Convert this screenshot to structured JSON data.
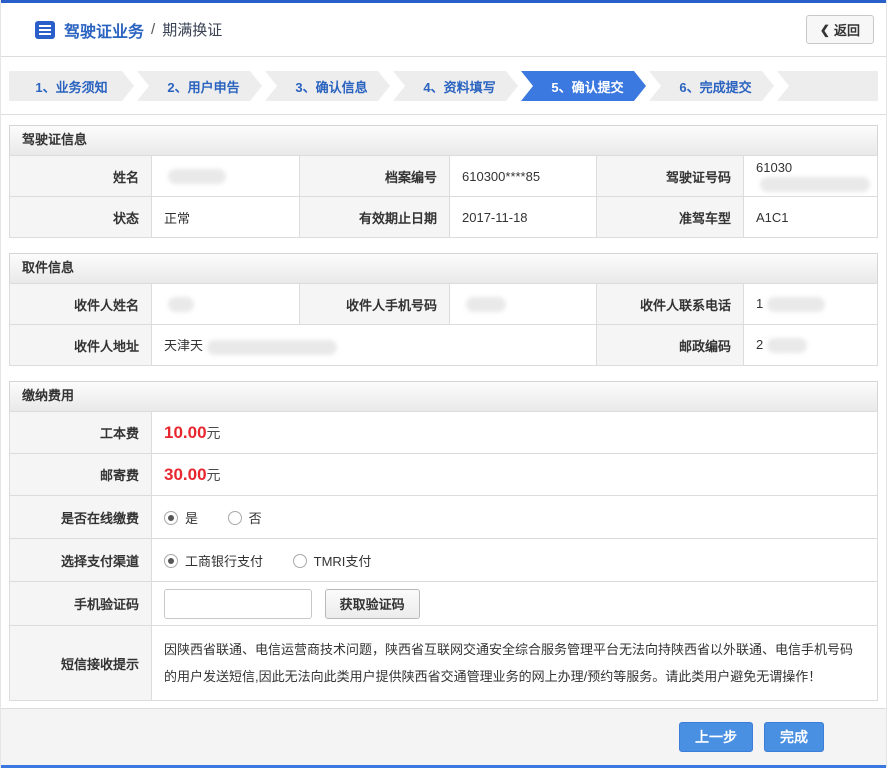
{
  "header": {
    "title_primary": "驾驶证业务",
    "title_separator": "/",
    "title_secondary": "期满换证",
    "back_chevron": "❮",
    "back_label": "返回"
  },
  "steps": {
    "items": [
      {
        "label": "1、业务须知",
        "active": false
      },
      {
        "label": "2、用户申告",
        "active": false
      },
      {
        "label": "3、确认信息",
        "active": false
      },
      {
        "label": "4、资料填写",
        "active": false
      },
      {
        "label": "5、确认提交",
        "active": true
      },
      {
        "label": "6、完成提交",
        "active": false
      }
    ]
  },
  "license": {
    "title": "驾驶证信息",
    "name_label": "姓名",
    "name_value": "",
    "file_no_label": "档案编号",
    "file_no_value": "610300****85",
    "license_no_label": "驾驶证号码",
    "license_no_value": "61030",
    "status_label": "状态",
    "status_value": "正常",
    "expiry_label": "有效期止日期",
    "expiry_value": "2017-11-18",
    "vehicle_class_label": "准驾车型",
    "vehicle_class_value": "A1C1"
  },
  "pickup": {
    "title": "取件信息",
    "recipient_name_label": "收件人姓名",
    "recipient_name_value": "",
    "recipient_mobile_label": "收件人手机号码",
    "recipient_mobile_value": "",
    "recipient_phone_label": "收件人联系电话",
    "recipient_phone_value": "1",
    "recipient_address_label": "收件人地址",
    "recipient_address_value": "天津天",
    "postcode_label": "邮政编码",
    "postcode_value": "2"
  },
  "fees": {
    "title": "缴纳费用",
    "cost_label": "工本费",
    "cost_value": "10.00",
    "cost_unit": "元",
    "postage_label": "邮寄费",
    "postage_value": "30.00",
    "postage_unit": "元",
    "online_pay_label": "是否在线缴费",
    "online_pay_yes": "是",
    "online_pay_no": "否",
    "online_pay_selected": "是",
    "channel_label": "选择支付渠道",
    "channel_icbc": "工商银行支付",
    "channel_tmri": "TMRI支付",
    "channel_selected": "工商银行支付",
    "sms_code_label": "手机验证码",
    "sms_code_value": "",
    "sms_code_button": "获取验证码",
    "sms_tip_label": "短信接收提示",
    "sms_tip_text": "因陕西省联通、电信运营商技术问题，陕西省互联网交通安全综合服务管理平台无法向持陕西省以外联通、电信手机号码的用户发送短信,因此无法向此类用户提供陕西省交通管理业务的网上办理/预约等服务。请此类用户避免无谓操作！"
  },
  "footer": {
    "prev_button": "上一步",
    "finish_button": "完成"
  },
  "colors": {
    "top_bar_blue": "#2a5ec9",
    "active_step_blue": "#3b78e0",
    "action_button_blue": "#4a90e2",
    "link_blue": "#2a63c0",
    "fee_red": "#e8262e",
    "warning_red": "#c0504d"
  }
}
